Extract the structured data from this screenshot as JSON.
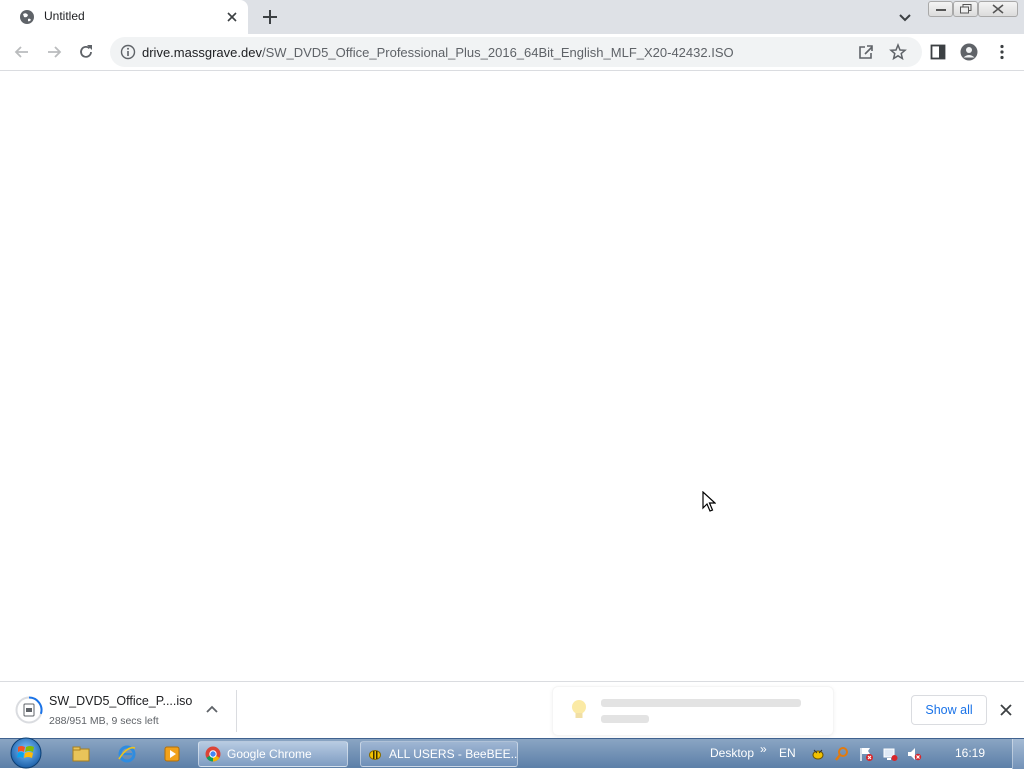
{
  "browser": {
    "tab": {
      "title": "Untitled"
    },
    "address_bar": {
      "url_domain": "drive.massgrave.dev",
      "url_path": "/SW_DVD5_Office_Professional_Plus_2016_64Bit_English_MLF_X20-42432.ISO"
    }
  },
  "download_bar": {
    "file_name": "SW_DVD5_Office_P....iso",
    "status": "288/951 MB, 9 secs left",
    "progress_fraction": 0.3,
    "show_all_label": "Show all"
  },
  "taskbar": {
    "tasks": [
      {
        "label": "Google Chrome"
      },
      {
        "label": "ALL USERS - BeeBEE..."
      }
    ],
    "tray": {
      "desktop_label": "Desktop",
      "chevron": "»",
      "language": "EN",
      "clock": "16:19"
    }
  },
  "icons": {
    "tab_favicon": "globe-icon",
    "toolbar": [
      "back-icon",
      "forward-icon",
      "reload-icon",
      "info-icon",
      "share-icon",
      "star-icon",
      "side-panel-icon",
      "profile-icon",
      "menu-icon"
    ],
    "tray": [
      "bee-icon",
      "search-icon",
      "flag-error-icon",
      "network-icon",
      "volume-muted-icon"
    ]
  },
  "colors": {
    "link_blue": "#1a73e8",
    "tab_strip": "#dee1e6",
    "taskbar": "#5c7fa8"
  }
}
